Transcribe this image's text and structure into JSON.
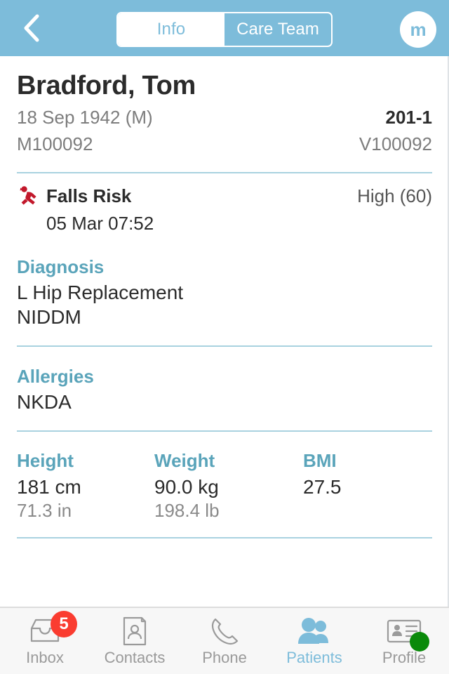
{
  "navbar": {
    "back_icon": "chevron-left-icon",
    "segments": [
      {
        "label": "Info",
        "active": true
      },
      {
        "label": "Care Team",
        "active": false
      }
    ],
    "avatar_initial": "m"
  },
  "patient": {
    "name": "Bradford, Tom",
    "dob_sex": "18 Sep 1942 (M)",
    "location": "201-1",
    "mrn": "M100092",
    "visit_id": "V100092"
  },
  "falls_risk": {
    "icon": "falling-person-icon",
    "label": "Falls Risk",
    "value": "High (60)",
    "timestamp": "05 Mar 07:52"
  },
  "diagnosis": {
    "title": "Diagnosis",
    "items": [
      "L Hip Replacement",
      "NIDDM"
    ]
  },
  "allergies": {
    "title": "Allergies",
    "items": [
      "NKDA"
    ]
  },
  "vitals": [
    {
      "title": "Height",
      "primary": "181 cm",
      "secondary": "71.3 in"
    },
    {
      "title": "Weight",
      "primary": "90.0 kg",
      "secondary": "198.4 lb"
    },
    {
      "title": "BMI",
      "primary": "27.5",
      "secondary": ""
    }
  ],
  "tabbar": [
    {
      "label": "Inbox",
      "icon": "inbox-tray-icon",
      "active": false,
      "badge": "5"
    },
    {
      "label": "Contacts",
      "icon": "contact-card-icon",
      "active": false
    },
    {
      "label": "Phone",
      "icon": "phone-handset-icon",
      "active": false
    },
    {
      "label": "Patients",
      "icon": "people-icon",
      "active": true
    },
    {
      "label": "Profile",
      "icon": "id-card-icon",
      "active": false,
      "status": "available"
    }
  ],
  "colors": {
    "header_blue": "#7dbcda",
    "section_teal": "#5aa4ba",
    "divider_blue": "#a9d2e0",
    "risk_red": "#c2182b",
    "badge_red": "#fa3c30",
    "status_green": "#0a8a0a",
    "text_dark": "#2b2b2b",
    "text_gray": "#7d7d7d"
  }
}
